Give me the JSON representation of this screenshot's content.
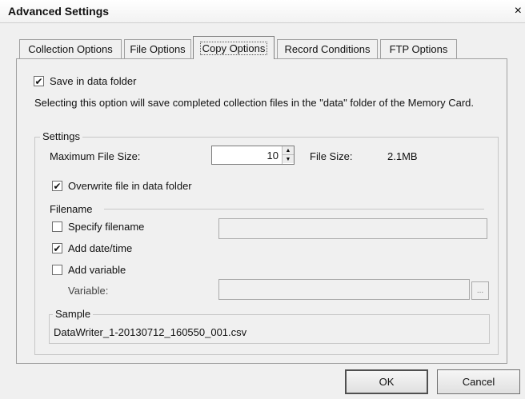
{
  "window": {
    "title": "Advanced Settings",
    "close_glyph": "×"
  },
  "tabs": [
    {
      "label": "Collection Options"
    },
    {
      "label": "File Options"
    },
    {
      "label": "Copy Options",
      "active": true
    },
    {
      "label": "Record Conditions"
    },
    {
      "label": "FTP Options"
    }
  ],
  "copy_options": {
    "save_in_data_folder": {
      "label": "Save in data folder",
      "checked": true
    },
    "description": "Selecting this option will save completed collection files in the \"data\" folder of the Memory Card.",
    "settings": {
      "legend": "Settings",
      "max_file_size_label": "Maximum File Size:",
      "max_file_size_value": "10",
      "file_size_label": "File Size:",
      "file_size_value": "2.1MB",
      "overwrite": {
        "label": "Overwrite file in data folder",
        "checked": true
      }
    },
    "filename": {
      "label": "Filename",
      "specify_filename": {
        "label": "Specify filename",
        "checked": false,
        "value": ""
      },
      "add_datetime": {
        "label": "Add date/time",
        "checked": true
      },
      "add_variable": {
        "label": "Add variable",
        "checked": false
      },
      "variable_label": "Variable:",
      "variable_value": "",
      "browse_label": "..."
    },
    "sample": {
      "legend": "Sample",
      "value": "DataWriter_1-20130712_160550_001.csv"
    }
  },
  "buttons": {
    "ok": "OK",
    "cancel": "Cancel"
  },
  "icons": {
    "check": "✔",
    "spin_up": "▲",
    "spin_down": "▼"
  }
}
